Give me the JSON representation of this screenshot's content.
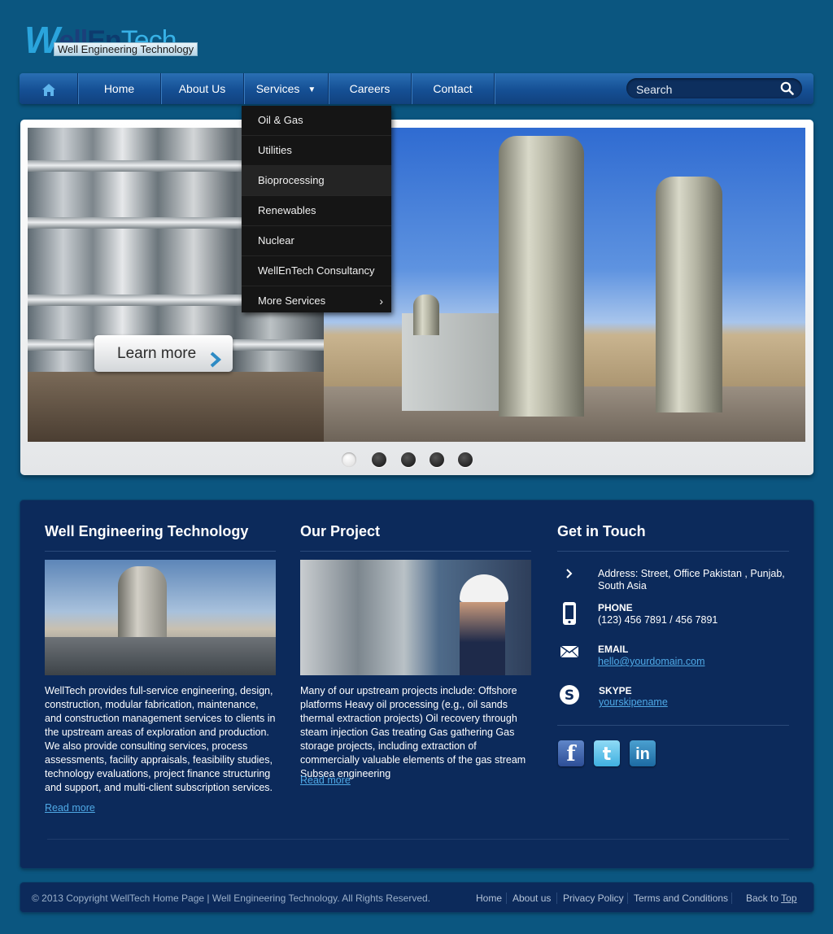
{
  "brand": {
    "logo_text_w": "W",
    "logo_text_ell": "ell",
    "logo_text_en": "En",
    "logo_text_tech": "Tech",
    "tagline": "Well Engineering Technology"
  },
  "nav": {
    "home_icon": "home-icon",
    "items": [
      {
        "label": "Home"
      },
      {
        "label": "About Us"
      },
      {
        "label": "Services"
      },
      {
        "label": "Careers"
      },
      {
        "label": "Contact"
      }
    ],
    "search_placeholder": "Search"
  },
  "services_menu": {
    "items": [
      {
        "label": "Oil & Gas"
      },
      {
        "label": "Utilities"
      },
      {
        "label": "Bioprocessing"
      },
      {
        "label": "Renewables"
      },
      {
        "label": "Nuclear"
      },
      {
        "label": "WellEnTech Consultancy"
      },
      {
        "label": "More Services"
      }
    ]
  },
  "slider": {
    "cta_label": "Learn more",
    "slide_count": 5,
    "active_slide": 1
  },
  "columns": {
    "about": {
      "title": "Well Engineering Technology",
      "text": "WellTech provides full-service engineering, design, construction, modular fabrication, maintenance, and construction management services to clients in the upstream areas of exploration and production. We also provide consulting services, process assessments, facility appraisals, feasibility studies, technology evaluations, project finance structuring and support, and multi-client subscription services.",
      "read_more": "Read more"
    },
    "project": {
      "title": "Our Project",
      "text": "Many of our upstream projects include: Offshore platforms Heavy oil processing (e.g., oil sands thermal extraction projects) Oil recovery through steam injection Gas treating Gas gathering Gas storage projects, including extraction of commercially valuable elements of the gas stream Subsea engineering",
      "read_more": "Read more"
    },
    "contact": {
      "title": "Get in Touch",
      "address": "Address: Street, Office Pakistan , Punjab, South Asia",
      "phone_label": "PHONE",
      "phone": "(123) 456 7891 / 456 7891",
      "email_label": "EMAIL",
      "email": "hello@yourdomain.com",
      "skype_label": "SKYPE",
      "skype": "yourskipename",
      "socials": [
        "facebook",
        "twitter",
        "linkedin"
      ]
    }
  },
  "footer": {
    "copyright": "© 2013 Copyright WellTech Home Page | Well Engineering Technology. All Rights Reserved.",
    "links": [
      {
        "label": "Home"
      },
      {
        "label": "About us"
      },
      {
        "label": "Privacy Policy"
      },
      {
        "label": "Terms and Conditions"
      }
    ],
    "back_to": "Back to",
    "top": "Top"
  },
  "colors": {
    "page_bg": "#0b5680",
    "panel_bg": "#0c2a5b",
    "nav_bg": "#154f94",
    "link": "#4fa9e6",
    "dropdown_bg": "#151515"
  }
}
